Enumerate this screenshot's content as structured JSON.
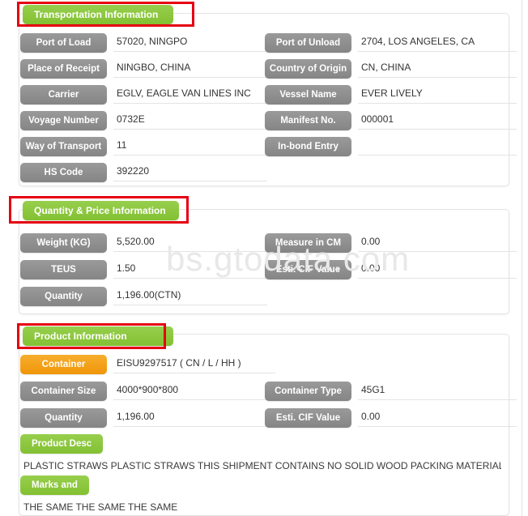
{
  "watermark": "bs.gtodata.com",
  "colors": {
    "section_green": "#8cc63e",
    "label_gray": "#8f8f8f",
    "accent_orange": "#f5a11b",
    "annotation_red": "#e60012",
    "card_border": "#e4e4e4",
    "value_underline": "#e3e3e3",
    "watermark_gray": "#e8e8e8"
  },
  "sections": [
    {
      "id": "transportation",
      "title": "Transportation Information",
      "left_fields": [
        {
          "label": "Port of Load",
          "value": "57020, NINGPO"
        },
        {
          "label": "Place of Receipt",
          "value": "NINGBO, CHINA"
        },
        {
          "label": "Carrier",
          "value": "EGLV, EAGLE VAN LINES INC"
        },
        {
          "label": "Voyage Number",
          "value": "0732E"
        },
        {
          "label": "Way of Transport",
          "value": "11"
        },
        {
          "label": "HS Code",
          "value": "392220"
        }
      ],
      "right_fields": [
        {
          "label": "Port of Unload",
          "value": "2704, LOS ANGELES, CA"
        },
        {
          "label": "Country of Origin",
          "value": "CN, CHINA"
        },
        {
          "label": "Vessel Name",
          "value": "EVER LIVELY"
        },
        {
          "label": "Manifest No.",
          "value": "000001"
        },
        {
          "label": "In-bond Entry",
          "value": ""
        }
      ]
    },
    {
      "id": "quantity",
      "title": "Quantity & Price Information",
      "left_fields": [
        {
          "label": "Weight (KG)",
          "value": "5,520.00"
        },
        {
          "label": "TEUS",
          "value": "1.50"
        },
        {
          "label": "Quantity",
          "value": "1,196.00(CTN)"
        }
      ],
      "right_fields": [
        {
          "label": "Measure in CM",
          "value": "0.00"
        },
        {
          "label": "Esti. CIF Value",
          "value": "0.00"
        }
      ]
    },
    {
      "id": "product",
      "title": "Product Information",
      "left_fields": [
        {
          "label": "Container",
          "value": "EISU9297517 ( CN / L / HH )",
          "accent": true
        },
        {
          "label": "Container Size",
          "value": "4000*900*800"
        },
        {
          "label": "Quantity",
          "value": "1,196.00"
        }
      ],
      "right_fields": [
        {
          "label": "Container Type",
          "value": "45G1"
        },
        {
          "label": "Esti. CIF Value",
          "value": "0.00"
        }
      ],
      "blocks": [
        {
          "label": "Product Desc",
          "text": "PLASTIC STRAWS PLASTIC STRAWS THIS SHIPMENT CONTAINS NO SOLID WOOD PACKING MATERIALS."
        },
        {
          "label": "Marks and",
          "text": "THE SAME THE SAME THE SAME"
        }
      ]
    }
  ]
}
